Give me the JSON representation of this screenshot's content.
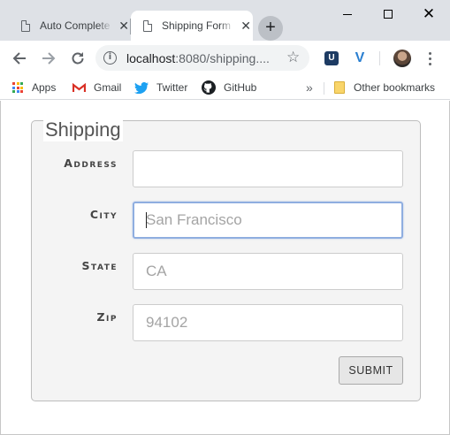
{
  "browser": {
    "tabs": [
      {
        "title": "Auto Complete",
        "active": false
      },
      {
        "title": "Shipping Form",
        "active": true
      }
    ],
    "tab_close_symbol": "✕",
    "new_tab_symbol": "+",
    "url": {
      "host": "localhost",
      "rest": ":8080/shipping...."
    },
    "extensions": [
      {
        "name": "u-extension-icon",
        "glyph": "U"
      },
      {
        "name": "v-extension-icon",
        "glyph": "V"
      }
    ],
    "bookmarks": [
      {
        "label": "Apps",
        "icon": "apps-grid-icon"
      },
      {
        "label": "Gmail",
        "icon": "gmail-icon"
      },
      {
        "label": "Twitter",
        "icon": "twitter-icon"
      },
      {
        "label": "GitHub",
        "icon": "github-icon"
      }
    ],
    "bookmarks_overflow": "»",
    "other_bookmarks": "Other bookmarks"
  },
  "form": {
    "legend": "Shipping",
    "fields": [
      {
        "label": "Address",
        "value": "",
        "placeholder": ""
      },
      {
        "label": "City",
        "value": "",
        "placeholder": "San Francisco",
        "focused": true
      },
      {
        "label": "State",
        "value": "",
        "placeholder": "CA"
      },
      {
        "label": "Zip",
        "value": "",
        "placeholder": "94102"
      }
    ],
    "submit_label": "SUBMIT"
  },
  "colors": {
    "tab_strip": "#dee1e6",
    "fieldset_bg": "#f4f4f4",
    "focus_border": "#8faee0"
  }
}
